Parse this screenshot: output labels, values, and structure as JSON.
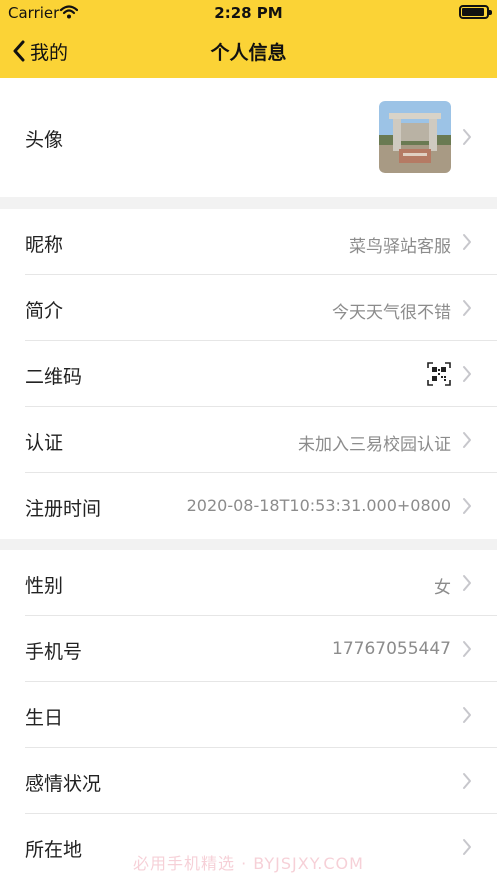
{
  "status_bar": {
    "carrier": "Carrier",
    "time": "2:28 PM"
  },
  "nav": {
    "back_label": "我的",
    "title": "个人信息"
  },
  "avatar_row": {
    "label": "头像"
  },
  "profile": {
    "rows": [
      {
        "label": "昵称",
        "value": "菜鸟驿站客服"
      },
      {
        "label": "简介",
        "value": "今天天气很不错"
      },
      {
        "label": "二维码",
        "value": "",
        "icon": "qr-code-icon"
      },
      {
        "label": "认证",
        "value": "未加入三易校园认证"
      },
      {
        "label": "注册时间",
        "value": "2020-08-18T10:53:31.000+0800"
      }
    ]
  },
  "personal": {
    "rows": [
      {
        "label": "性别",
        "value": "女"
      },
      {
        "label": "手机号",
        "value": "17767055447"
      },
      {
        "label": "生日",
        "value": ""
      },
      {
        "label": "感情状况",
        "value": ""
      },
      {
        "label": "所在地",
        "value": ""
      }
    ]
  },
  "watermark": "必用手机精选 · BYJSJXY.COM",
  "colors": {
    "accent": "#fbd336",
    "value_text": "#8c8c8c",
    "chevron": "#c7c7cc",
    "background": "#f2f2f2"
  }
}
